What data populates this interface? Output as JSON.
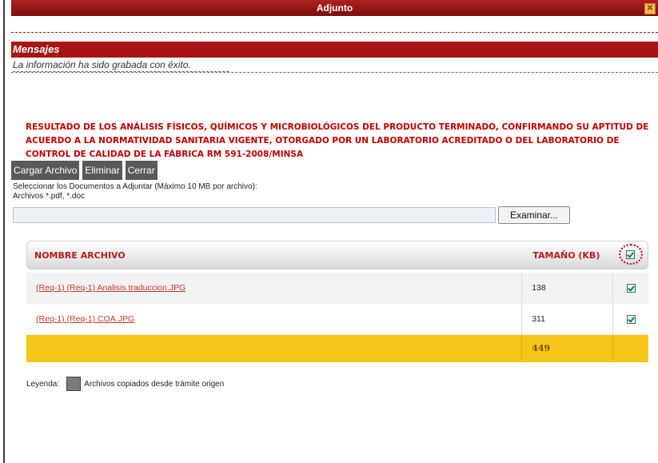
{
  "window": {
    "title": "Adjunto",
    "close_icon": "close-icon"
  },
  "messages": {
    "header": "Mensajes",
    "text": "La información ha sido grabada con éxito."
  },
  "description": "RESULTADO DE LOS ANÁLISIS FÍSICOS, QUÍMICOS Y MICROBIOLÓGICOS DEL PRODUCTO TERMINADO, CONFIRMANDO SU APTITUD DE ACUERDO A LA NORMATIVIDAD SANITARIA VIGENTE, OTORGADO POR UN LABORATORIO ACREDITADO O DEL LABORATORIO DE CONTROL DE CALIDAD DE LA FÁBRICA RM 591-2008/MINSA",
  "toolbar": {
    "upload_label": "Cargar Archivo",
    "delete_label": "Eliminar",
    "close_label": "Cerrar"
  },
  "instructions": {
    "line1": "Seleccionar los Documentos a Adjuntar (Máximo 10 MB por archivo):",
    "line2": "Archivos *.pdf, *.doc"
  },
  "file_input": {
    "value": "",
    "browse_label": "Examinar..."
  },
  "table": {
    "headers": {
      "name": "NOMBRE ARCHIVO",
      "size": "TAMAÑO (KB)"
    },
    "header_checked": true,
    "rows": [
      {
        "name": "(Req-1) (Req-1) Analisis traduccion.JPG",
        "size": "138",
        "checked": true
      },
      {
        "name": "(Req-1) (Req-1) COA.JPG",
        "size": "311",
        "checked": true
      }
    ],
    "total": "449"
  },
  "legend": {
    "label": "Leyenda:",
    "text": "Archivos copiados desde trámite origen",
    "swatch_color": "#7a7a7a"
  }
}
